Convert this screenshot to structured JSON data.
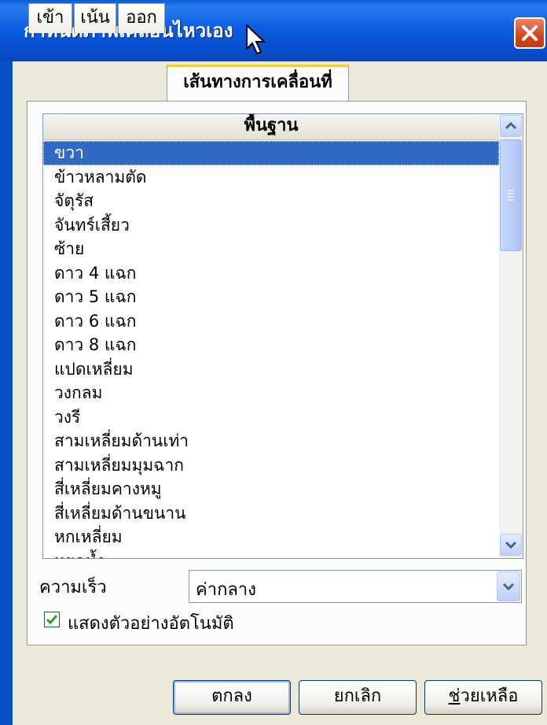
{
  "window": {
    "title": "กำหนดภาพเคลื่อนไหวเอง"
  },
  "tabs": [
    {
      "label": "เข้า"
    },
    {
      "label": "เน้น"
    },
    {
      "label": "ออก"
    },
    {
      "label": "เส้นทางการเคลื่อนที่",
      "active": true
    }
  ],
  "list": {
    "header": "พื้นฐาน",
    "selected_index": 0,
    "items": [
      "ขวา",
      "ข้าวหลามตัด",
      "จัตุรัส",
      "จันทร์เสี้ยว",
      "ซ้าย",
      "ดาว 4 แฉก",
      "ดาว 5 แฉก",
      "ดาว 6 แฉก",
      "ดาว 8 แฉก",
      "แปดเหลี่ยม",
      "วงกลม",
      "วงรี",
      "สามเหลี่ยมด้านเท่า",
      "สามเหลี่ยมมุมฉาก",
      "สี่เหลี่ยมคางหมู",
      "สี่เหลี่ยมด้านขนาน",
      "หกเหลี่ยม",
      "หยดน้ำ"
    ]
  },
  "speed": {
    "label": "ความเร็ว",
    "value": "ค่ากลาง"
  },
  "autopreview": {
    "label": "แสดงตัวอย่างอัตโนมัติ",
    "checked": true
  },
  "buttons": {
    "ok": "ตกลง",
    "cancel": "ยกเลิก",
    "help_first": "ช",
    "help_rest": "่วยเหลือ"
  },
  "colors": {
    "titlebar": "#0a5fd8",
    "selection": "#316ac5",
    "dialog_bg": "#ece9d8",
    "active_tab_accent": "#ffc83c"
  }
}
